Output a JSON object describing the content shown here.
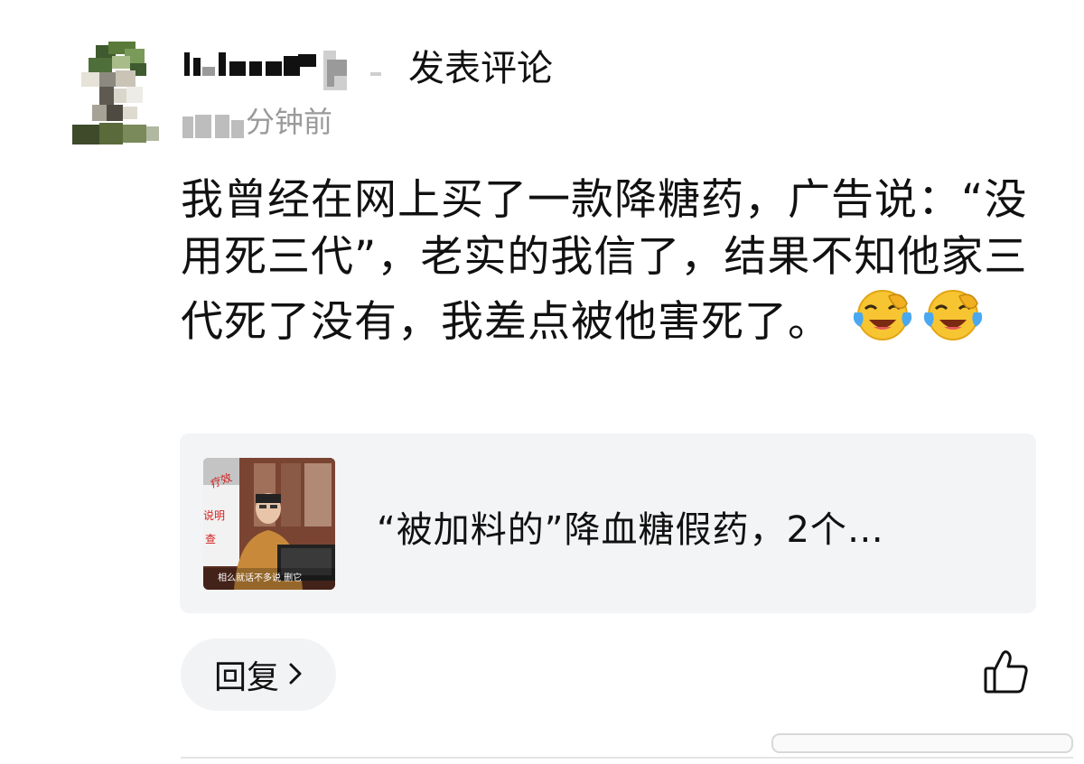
{
  "user": {
    "name_visible_suffix": "发表评论",
    "time_visible_suffix": "分钟前"
  },
  "comment": {
    "text": "我曾经在网上买了一款降糖药，广告说：“没用死三代”，老实的我信了，结果不知他家三代死了没有，我差点被他害死了。",
    "emojis": [
      "laughing-crying-emoji",
      "laughing-crying-emoji"
    ]
  },
  "link_card": {
    "title": "“被加料的”降血糖假药，2个…",
    "thumbnail": {
      "caption": "相么就话不多说 删它",
      "side_text": [
        "疗效",
        "说明",
        "查"
      ]
    }
  },
  "actions": {
    "reply_label": "回复",
    "reply_chevron": "›",
    "like_icon": "thumbs-up-icon"
  },
  "colors": {
    "text": "#111111",
    "muted": "#9a9a9a",
    "card_bg": "#f3f4f6",
    "reply_bg": "#f2f3f5"
  }
}
